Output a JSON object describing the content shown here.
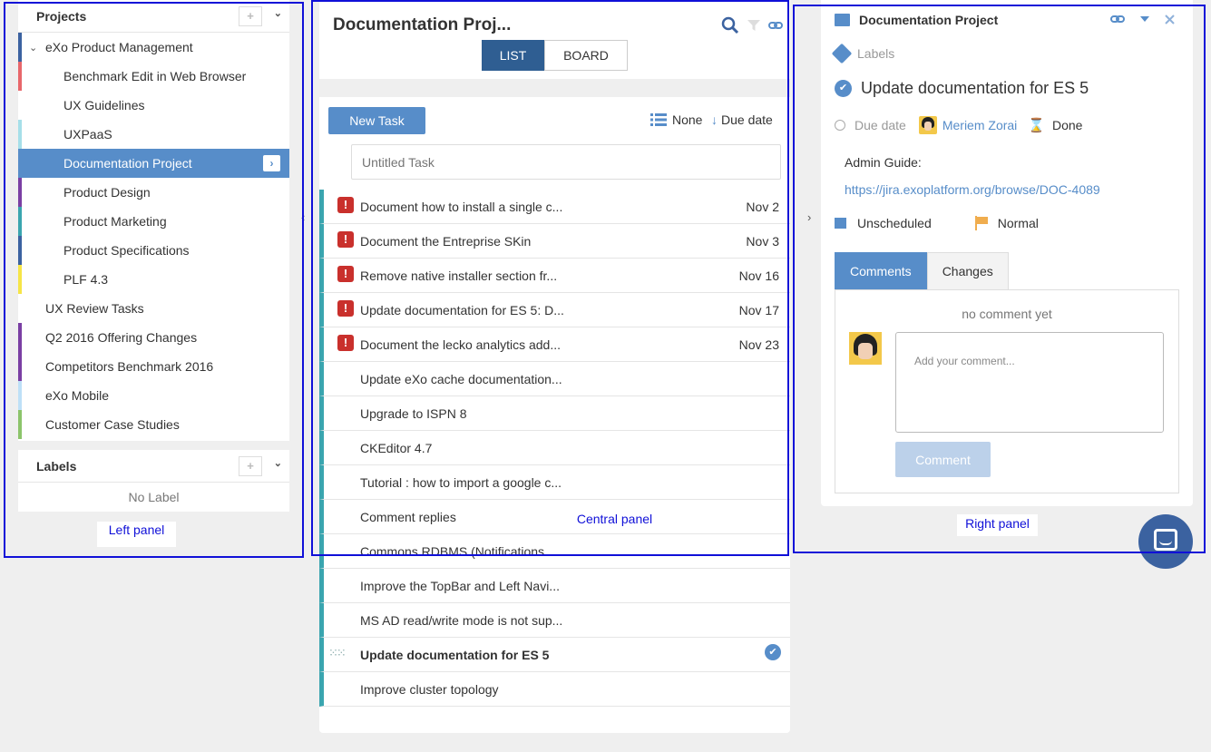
{
  "left_panel": {
    "projects_title": "Projects",
    "add_symbol": "+",
    "projects": [
      {
        "label": "eXo Product Management",
        "level": 0,
        "color": "#3b62a0",
        "expanded": true
      },
      {
        "label": "Benchmark Edit in Web Browser",
        "level": 1,
        "color": "#e8676b"
      },
      {
        "label": "UX Guidelines",
        "level": 1,
        "color": ""
      },
      {
        "label": "UXPaaS",
        "level": 1,
        "color": "#a6dfe9"
      },
      {
        "label": "Documentation Project",
        "level": 1,
        "color": "#578dc9",
        "active": true
      },
      {
        "label": "Product Design",
        "level": 1,
        "color": "#7a3fa3"
      },
      {
        "label": "Product Marketing",
        "level": 1,
        "color": "#3aa5af"
      },
      {
        "label": "Product Specifications",
        "level": 1,
        "color": "#3b62a0"
      },
      {
        "label": "PLF 4.3",
        "level": 1,
        "color": "#f6e547"
      },
      {
        "label": "UX Review Tasks",
        "level": 0,
        "color": ""
      },
      {
        "label": "Q2 2016 Offering Changes",
        "level": 0,
        "color": "#7a3fa3"
      },
      {
        "label": "Competitors Benchmark 2016",
        "level": 0,
        "color": "#7a3fa3"
      },
      {
        "label": "eXo Mobile",
        "level": 0,
        "color": "#bee0f7"
      },
      {
        "label": "Customer Case Studies",
        "level": 0,
        "color": "#8cc46b"
      }
    ],
    "labels_title": "Labels",
    "no_label": "No Label"
  },
  "center_panel": {
    "title": "Documentation Proj...",
    "view_list": "LIST",
    "view_board": "BOARD",
    "new_task": "New Task",
    "group_by": "None",
    "sort_by": "Due date",
    "add_placeholder": "Untitled Task",
    "tasks": [
      {
        "title": "Document how to install a single c...",
        "due": "Nov 2",
        "urgent": true
      },
      {
        "title": "Document the Entreprise SKin",
        "due": "Nov 3",
        "urgent": true
      },
      {
        "title": "Remove native installer section fr...",
        "due": "Nov 16",
        "urgent": true
      },
      {
        "title": "Update documentation for ES 5: D...",
        "due": "Nov 17",
        "urgent": true
      },
      {
        "title": "Document the lecko analytics add...",
        "due": "Nov 23",
        "urgent": true
      },
      {
        "title": "Update eXo cache documentation...",
        "due": "",
        "urgent": false
      },
      {
        "title": "Upgrade to ISPN 8",
        "due": "",
        "urgent": false
      },
      {
        "title": "CKEditor 4.7",
        "due": "",
        "urgent": false
      },
      {
        "title": "Tutorial : how to import a google c...",
        "due": "",
        "urgent": false
      },
      {
        "title": "Comment replies",
        "due": "",
        "urgent": false
      },
      {
        "title": "Commons RDBMS (Notifications...",
        "due": "",
        "urgent": false
      },
      {
        "title": "Improve the TopBar and Left Navi...",
        "due": "",
        "urgent": false
      },
      {
        "title": "MS AD read/write mode is not sup...",
        "due": "",
        "urgent": false
      },
      {
        "title": "Update documentation for ES 5",
        "due": "",
        "urgent": false,
        "selected": true,
        "done": true
      },
      {
        "title": "Improve cluster topology",
        "due": "",
        "urgent": false
      }
    ]
  },
  "right_panel": {
    "project_name": "Documentation Project",
    "labels": "Labels",
    "task_title": "Update documentation for ES 5",
    "due_date_label": "Due date",
    "assignee": "Meriem Zorai",
    "status": "Done",
    "description": "Admin Guide:",
    "description_link": "https://jira.exoplatform.org/browse/DOC-4089",
    "schedule": "Unscheduled",
    "priority": "Normal",
    "tab_comments": "Comments",
    "tab_changes": "Changes",
    "no_comment": "no comment yet",
    "comment_placeholder": "Add your comment...",
    "comment_button": "Comment"
  },
  "annotations": {
    "left": "Left panel",
    "center": "Central panel",
    "right": "Right panel"
  },
  "colors": {
    "accent": "#578dc9",
    "task_bar": "#3aa5af",
    "urgent": "#c9302c",
    "annotation": "#1010d8"
  }
}
